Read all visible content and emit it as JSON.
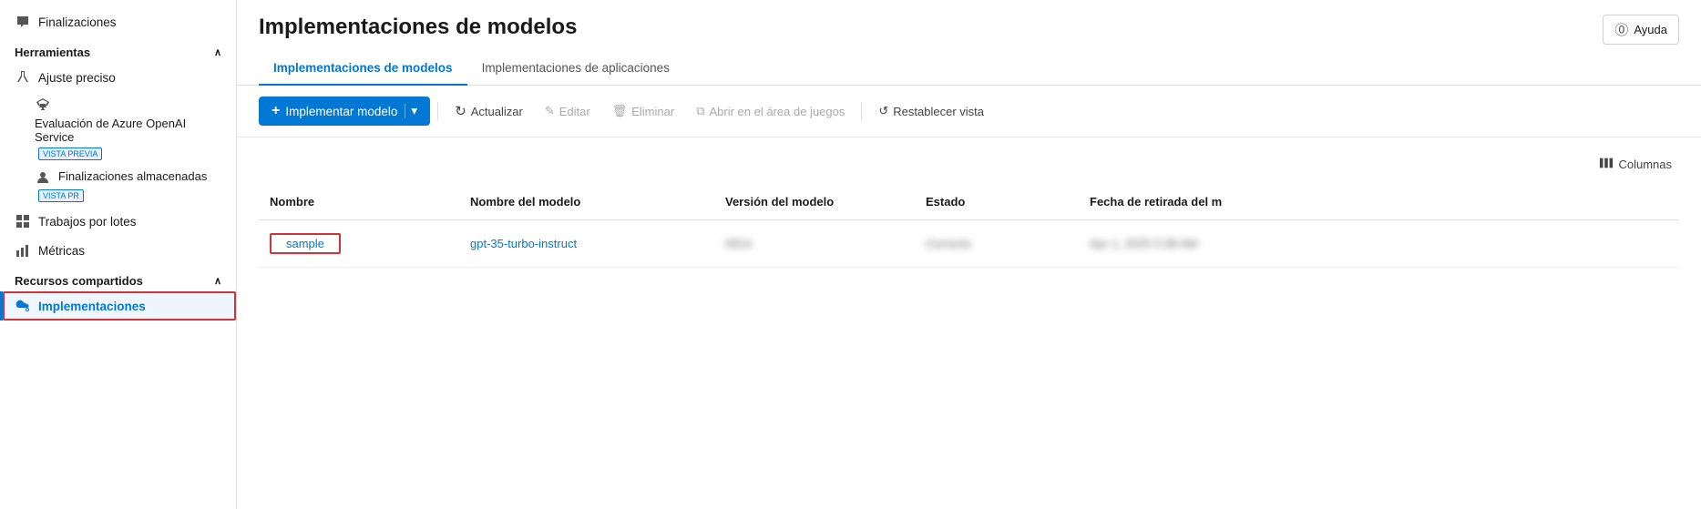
{
  "sidebar": {
    "sections": [
      {
        "label": "Herramientas",
        "collapsible": true,
        "collapsed": false,
        "items": [
          {
            "id": "ajuste-preciso",
            "label": "Ajuste preciso",
            "icon": "flask",
            "preview": false,
            "active": false
          },
          {
            "id": "evaluacion-azure",
            "label": "Evaluación de Azure OpenAI Service",
            "icon": "scale",
            "preview": true,
            "badge": "VISTA PREVIA",
            "active": false
          },
          {
            "id": "finalizaciones-almacenadas",
            "label": "Finalizaciones almacenadas",
            "icon": "person",
            "preview": true,
            "badge": "VISTA PR",
            "active": false
          },
          {
            "id": "trabajos-lotes",
            "label": "Trabajos por lotes",
            "icon": "table",
            "active": false
          },
          {
            "id": "metricas",
            "label": "Métricas",
            "icon": "chart",
            "active": false
          }
        ]
      },
      {
        "label": "Recursos compartidos",
        "collapsible": true,
        "collapsed": false,
        "items": [
          {
            "id": "implementaciones",
            "label": "Implementaciones",
            "icon": "cloud",
            "active": true
          }
        ]
      }
    ],
    "top_items": [
      {
        "id": "finalizaciones",
        "label": "Finalizaciones",
        "icon": "chat"
      }
    ]
  },
  "page": {
    "title": "Implementaciones de modelos",
    "help_label": "Ayuda"
  },
  "tabs": [
    {
      "id": "modelos",
      "label": "Implementaciones de modelos",
      "active": true
    },
    {
      "id": "aplicaciones",
      "label": "Implementaciones de aplicaciones",
      "active": false
    }
  ],
  "toolbar": {
    "implement_label": "Implementar modelo",
    "actualizar_label": "Actualizar",
    "editar_label": "Editar",
    "eliminar_label": "Eliminar",
    "abrir_label": "Abrir en el área de juegos",
    "restablecer_label": "Restablecer vista",
    "columns_label": "Columnas"
  },
  "table": {
    "headers": [
      "Nombre",
      "Nombre del modelo",
      "Versión del modelo",
      "Estado",
      "Fecha de retirada del m"
    ],
    "rows": [
      {
        "nombre": "sample",
        "modelo": "gpt-35-turbo-instruct",
        "version": "0914",
        "estado": "Correcto",
        "fecha": "Apr 1, 2025 5:38 AM"
      }
    ]
  }
}
